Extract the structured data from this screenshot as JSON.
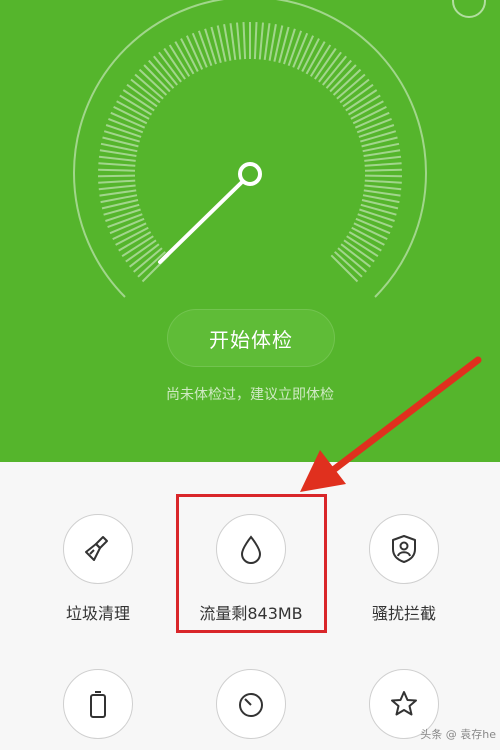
{
  "check": {
    "start_button": "开始体检",
    "hint": "尚未体检过，建议立即体检"
  },
  "tools": [
    {
      "label": "垃圾清理",
      "icon": "broom-icon"
    },
    {
      "label": "流量剩843MB",
      "icon": "water-drop-icon"
    },
    {
      "label": "骚扰拦截",
      "icon": "shield-user-icon"
    },
    {
      "label": "",
      "icon": "battery-icon"
    },
    {
      "label": "",
      "icon": "timer-icon"
    },
    {
      "label": "",
      "icon": "star-icon"
    }
  ],
  "watermark": "头条 @ 袁存he",
  "colors": {
    "primary_green": "#55b52c",
    "highlight_red": "#d9262a",
    "background": "#f7f7f7"
  }
}
